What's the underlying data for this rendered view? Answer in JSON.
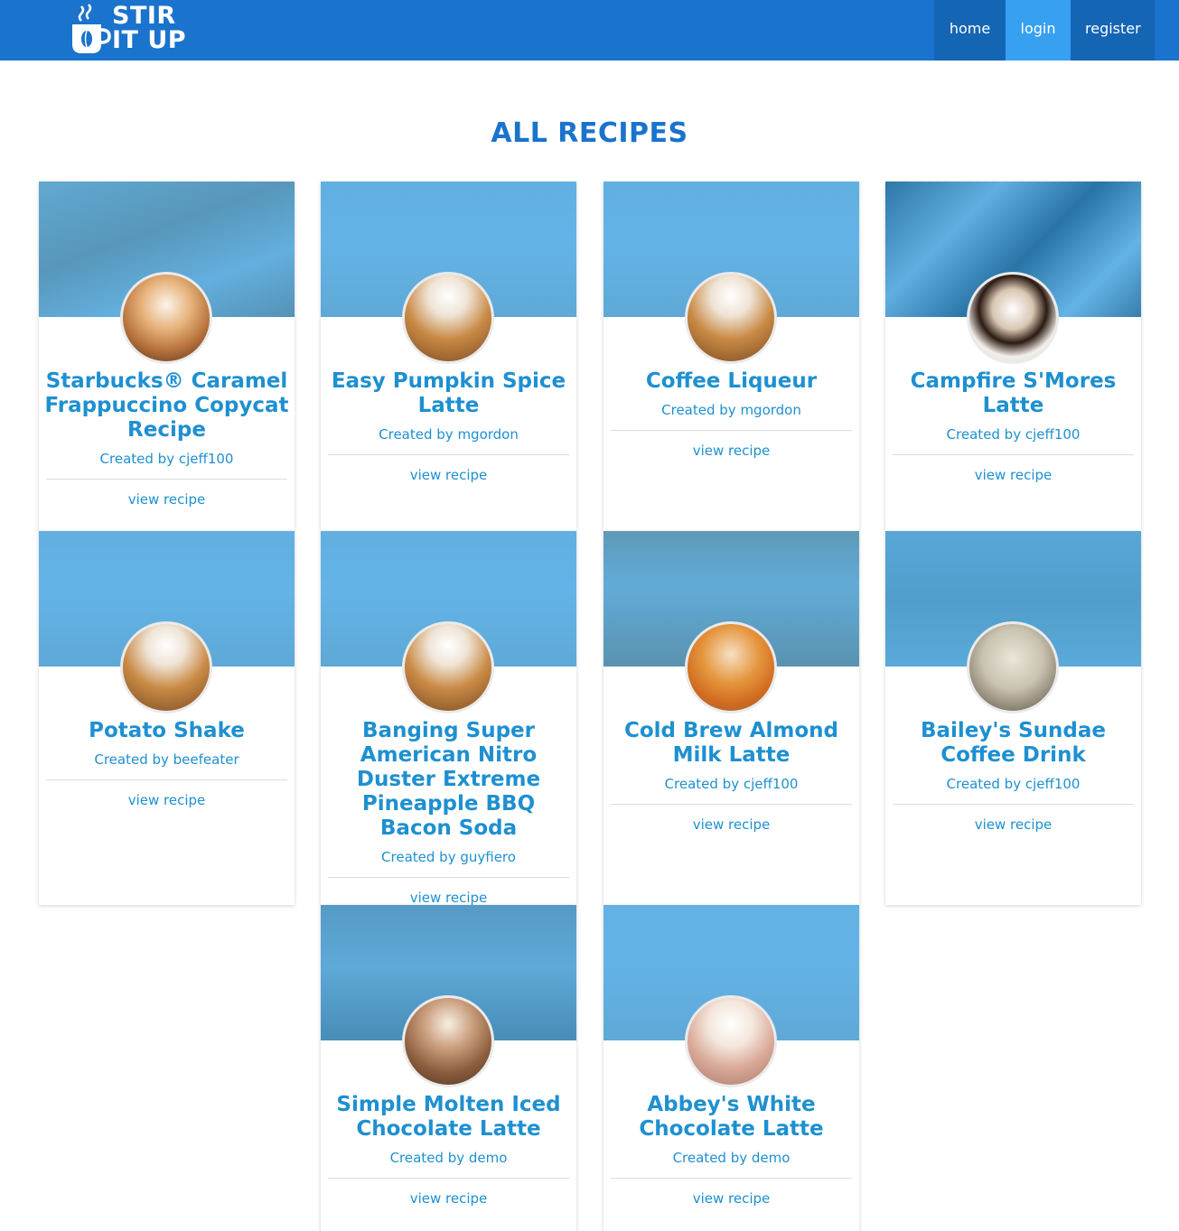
{
  "header": {
    "logo_line1": "STIR",
    "logo_line2": "IT UP",
    "nav": [
      {
        "label": "home"
      },
      {
        "label": "login"
      },
      {
        "label": "register"
      }
    ]
  },
  "page_title": "ALL RECIPES",
  "view_label": "view recipe",
  "recipes": [
    {
      "title": "Starbucks® Caramel Frappuccino Copycat Recipe",
      "author": "Created by cjeff100"
    },
    {
      "title": "Easy Pumpkin Spice Latte",
      "author": "Created by mgordon"
    },
    {
      "title": "Coffee Liqueur",
      "author": "Created by mgordon"
    },
    {
      "title": "Campfire S'Mores Latte",
      "author": "Created by cjeff100"
    },
    {
      "title": "Potato Shake",
      "author": "Created by beefeater"
    },
    {
      "title": "Banging Super American Nitro Duster Extreme Pineapple BBQ Bacon Soda",
      "author": "Created by guyfiero"
    },
    {
      "title": "Cold Brew Almond Milk Latte",
      "author": "Created by cjeff100"
    },
    {
      "title": "Bailey's Sundae Coffee Drink",
      "author": "Created by cjeff100"
    },
    {
      "title": "Simple Molten Iced Chocolate Latte",
      "author": "Created by demo"
    },
    {
      "title": "Abbey's White Chocolate Latte",
      "author": "Created by demo"
    }
  ],
  "colors": {
    "navbar": "#1a73cc",
    "nav_active": "#38a0f0",
    "accent_text": "#1e90d0"
  }
}
